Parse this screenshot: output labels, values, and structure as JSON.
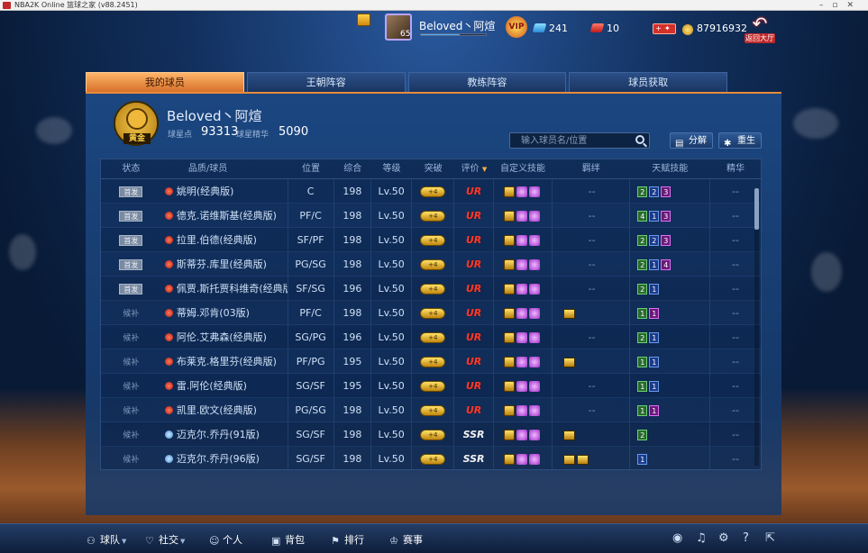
{
  "window": {
    "title": "NBA2K Online 篮球之家 (v88.2451)"
  },
  "topbar": {
    "player_name": "Beloved丶阿煊",
    "avatar_level": "65",
    "vip_label": "VIP",
    "exp_fraction": 0.6,
    "tickets": "241",
    "cards": "10",
    "coins": "87916932",
    "back_label": "返回大厅"
  },
  "tabs": [
    {
      "label": "我的球员",
      "active": true
    },
    {
      "label": "王朝阵容",
      "active": false
    },
    {
      "label": "教练阵容",
      "active": false
    },
    {
      "label": "球员获取",
      "active": false
    }
  ],
  "profile": {
    "badge_label": "黄金",
    "owner_name": "Beloved丶阿煊",
    "star_points_label": "球星点",
    "star_points": "93313",
    "essence_label": "球星精华",
    "essence": "5090"
  },
  "toolbar": {
    "search_placeholder": "输入球员名/位置",
    "decompose_label": "分解",
    "rebirth_label": "重生"
  },
  "table": {
    "headers": {
      "status": "状态",
      "player": "品质/球员",
      "position": "位置",
      "overall": "综合",
      "level": "等级",
      "breakthrough": "突破",
      "rating": "评价",
      "custom_skills": "自定义技能",
      "bond": "羁绊",
      "talent": "天赋技能",
      "essence": "精华"
    },
    "rows": [
      {
        "status": "首发",
        "starter": true,
        "quality": "red",
        "name": "姚明(经典版)",
        "position": "C",
        "overall": "198",
        "level": "Lv.50",
        "break": "+4",
        "rating": "UR",
        "bond": "--",
        "bond_icons": 0,
        "talent": [
          [
            "2",
            "g"
          ],
          [
            "2",
            "b"
          ],
          [
            "3",
            "p"
          ]
        ],
        "essence": "--"
      },
      {
        "status": "首发",
        "starter": true,
        "quality": "red",
        "name": "德克.诺维斯基(经典版)",
        "position": "PF/C",
        "overall": "198",
        "level": "Lv.50",
        "break": "+4",
        "rating": "UR",
        "bond": "--",
        "bond_icons": 0,
        "talent": [
          [
            "4",
            "g"
          ],
          [
            "1",
            "b"
          ],
          [
            "3",
            "p"
          ]
        ],
        "essence": "--"
      },
      {
        "status": "首发",
        "starter": true,
        "quality": "red",
        "name": "拉里.伯德(经典版)",
        "position": "SF/PF",
        "overall": "198",
        "level": "Lv.50",
        "break": "+4",
        "rating": "UR",
        "bond": "--",
        "bond_icons": 0,
        "talent": [
          [
            "2",
            "g"
          ],
          [
            "2",
            "b"
          ],
          [
            "3",
            "p"
          ]
        ],
        "essence": "--"
      },
      {
        "status": "首发",
        "starter": true,
        "quality": "red",
        "name": "斯蒂芬.库里(经典版)",
        "position": "PG/SG",
        "overall": "198",
        "level": "Lv.50",
        "break": "+4",
        "rating": "UR",
        "bond": "--",
        "bond_icons": 0,
        "talent": [
          [
            "2",
            "g"
          ],
          [
            "1",
            "b"
          ],
          [
            "4",
            "p"
          ]
        ],
        "essence": "--"
      },
      {
        "status": "首发",
        "starter": true,
        "quality": "red",
        "name": "佩贾.斯托贾科维奇(经典版)",
        "position": "SF/SG",
        "overall": "196",
        "level": "Lv.50",
        "break": "+4",
        "rating": "UR",
        "bond": "--",
        "bond_icons": 0,
        "talent": [
          [
            "2",
            "g"
          ],
          [
            "1",
            "b"
          ]
        ],
        "essence": "--"
      },
      {
        "status": "候补",
        "starter": false,
        "quality": "red",
        "name": "蒂姆.邓肯(03版)",
        "position": "PF/C",
        "overall": "198",
        "level": "Lv.50",
        "break": "+4",
        "rating": "UR",
        "bond": "",
        "bond_icons": 1,
        "talent": [
          [
            "1",
            "g"
          ],
          [
            "1",
            "p"
          ]
        ],
        "essence": "--"
      },
      {
        "status": "候补",
        "starter": false,
        "quality": "red",
        "name": "阿伦.艾弗森(经典版)",
        "position": "SG/PG",
        "overall": "196",
        "level": "Lv.50",
        "break": "+4",
        "rating": "UR",
        "bond": "--",
        "bond_icons": 0,
        "talent": [
          [
            "2",
            "g"
          ],
          [
            "1",
            "b"
          ]
        ],
        "essence": "--"
      },
      {
        "status": "候补",
        "starter": false,
        "quality": "red",
        "name": "布莱克.格里芬(经典版)",
        "position": "PF/PG",
        "overall": "195",
        "level": "Lv.50",
        "break": "+4",
        "rating": "UR",
        "bond": "",
        "bond_icons": 1,
        "talent": [
          [
            "1",
            "g"
          ],
          [
            "1",
            "b"
          ]
        ],
        "essence": "--"
      },
      {
        "status": "候补",
        "starter": false,
        "quality": "red",
        "name": "雷.阿伦(经典版)",
        "position": "SG/SF",
        "overall": "195",
        "level": "Lv.50",
        "break": "+4",
        "rating": "UR",
        "bond": "--",
        "bond_icons": 0,
        "talent": [
          [
            "1",
            "g"
          ],
          [
            "1",
            "b"
          ]
        ],
        "essence": "--"
      },
      {
        "status": "候补",
        "starter": false,
        "quality": "red",
        "name": "凯里.欧文(经典版)",
        "position": "PG/SG",
        "overall": "198",
        "level": "Lv.50",
        "break": "+4",
        "rating": "UR",
        "bond": "--",
        "bond_icons": 0,
        "talent": [
          [
            "1",
            "g"
          ],
          [
            "1",
            "p"
          ]
        ],
        "essence": "--"
      },
      {
        "status": "候补",
        "starter": false,
        "quality": "blue",
        "name": "迈克尔.乔丹(91版)",
        "position": "SG/SF",
        "overall": "198",
        "level": "Lv.50",
        "break": "+4",
        "rating": "SSR",
        "bond": "",
        "bond_icons": 1,
        "talent": [
          [
            "2",
            "g"
          ]
        ],
        "essence": "--"
      },
      {
        "status": "候补",
        "starter": false,
        "quality": "blue",
        "name": "迈克尔.乔丹(96版)",
        "position": "SG/SF",
        "overall": "198",
        "level": "Lv.50",
        "break": "+4",
        "rating": "SSR",
        "bond": "",
        "bond_icons": 2,
        "talent": [
          [
            "1",
            "b"
          ]
        ],
        "essence": "--"
      }
    ]
  },
  "bottom_nav": [
    {
      "label": "球队",
      "icon": "person-icon",
      "glyph": "⚇",
      "has_menu": true
    },
    {
      "label": "社交",
      "icon": "heart-icon",
      "glyph": "♡",
      "has_menu": true
    },
    {
      "label": "个人",
      "icon": "user-icon",
      "glyph": "☺",
      "has_menu": false
    },
    {
      "label": "背包",
      "icon": "bag-icon",
      "glyph": "▣",
      "has_menu": false
    },
    {
      "label": "排行",
      "icon": "rank-icon",
      "glyph": "⚑",
      "has_menu": false
    },
    {
      "label": "赛事",
      "icon": "trophy-icon",
      "glyph": "♔",
      "has_menu": false
    }
  ],
  "colors": {
    "tab_active": "#d7702a",
    "panel": "#163a6c",
    "rating_ur": "#ff3a2a"
  }
}
